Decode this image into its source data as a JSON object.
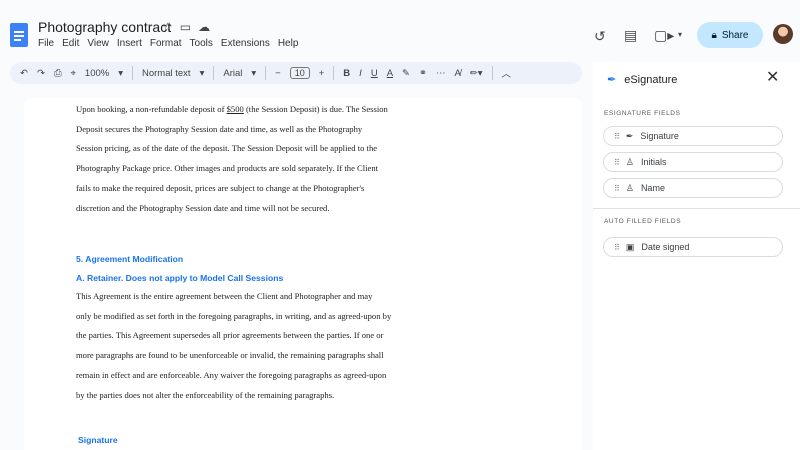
{
  "app": {
    "doc_title": "Photography contract",
    "menu": [
      "File",
      "Edit",
      "View",
      "Insert",
      "Format",
      "Tools",
      "Extensions",
      "Help"
    ],
    "share_label": "Share"
  },
  "toolbar": {
    "zoom": "100%",
    "style": "Normal text",
    "font": "Arial",
    "font_size": "10"
  },
  "document": {
    "para1_lines": [
      "Upon booking, a non-refundable deposit of $500 (the Session Deposit) is due. The Session",
      "Deposit secures the Photography Session date and time, as well as the Photography",
      "Session pricing, as of the date of the deposit. The Session Deposit will be applied to the",
      "Photography Package price. Other images and products are sold separately. If the Client",
      "fails to make the required deposit, prices are subject to change at the Photographer's",
      "discretion and the Photography Session date and time will not be secured."
    ],
    "heading1": "5. Agreement Modification",
    "heading2": "A. Retainer.  Does not apply to Model Call Sessions",
    "para2_lines": [
      "This Agreement is the entire agreement between the Client and Photographer and may",
      "only be modified as set forth in the foregoing paragraphs, in writing, and as agreed-upon by",
      "the parties.  This Agreement supersedes all prior agreements between the parties. If one or",
      "more paragraphs are found to be unenforceable or invalid, the remaining paragraphs shall",
      "remain in effect and are enforceable. Any waiver the foregoing paragraphs as agreed-upon",
      "by the parties does not alter the enforceability of the remaining paragraphs."
    ],
    "heading3": "Signature"
  },
  "sidebar": {
    "title": "eSignature",
    "section1": "ESIGNATURE FIELDS",
    "fields": [
      "Signature",
      "Initials",
      "Name"
    ],
    "section2": "AUTO FILLED FIELDS",
    "auto_fields": [
      "Date signed"
    ]
  }
}
